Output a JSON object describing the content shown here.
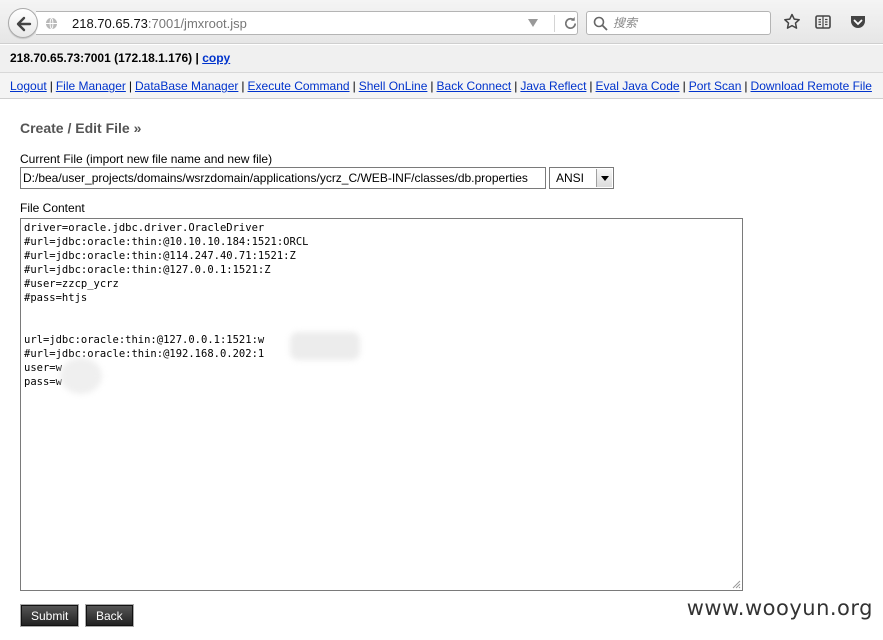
{
  "browser": {
    "url_host": "218.70.65.73",
    "url_rest": ":7001/jmxroot.jsp",
    "search_placeholder": "搜索"
  },
  "infobar": {
    "host": "218.70.65.73:7001",
    "ip": " (172.18.1.176) | ",
    "copy_label": "copy"
  },
  "menu": {
    "items": [
      "Logout",
      "File Manager",
      "DataBase Manager",
      "Execute Command",
      "Shell OnLine",
      "Back Connect",
      "Java Reflect",
      "Eval Java Code",
      "Port Scan",
      "Download Remote File"
    ]
  },
  "page": {
    "title": "Create / Edit File »",
    "current_file_label": "Current File (import new file name and new file)",
    "current_file_path": "D:/bea/user_projects/domains/wsrzdomain/applications/ycrz_C/WEB-INF/classes/db.properties",
    "encoding": "ANSI",
    "file_content_label": "File Content",
    "file_content": "driver=oracle.jdbc.driver.OracleDriver\n#url=jdbc:oracle:thin:@10.10.10.184:1521:ORCL\n#url=jdbc:oracle:thin:@114.247.40.71:1521:Z\n#url=jdbc:oracle:thin:@127.0.0.1:1521:Z\n#user=zzcp_ycrz\n#pass=htjs\n\n\nurl=jdbc:oracle:thin:@127.0.0.1:1521:w\n#url=jdbc:oracle:thin:@192.168.0.202:1\nuser=w\npass=w",
    "submit_label": "Submit",
    "back_label": "Back"
  },
  "watermark": "www.wooyun.org"
}
